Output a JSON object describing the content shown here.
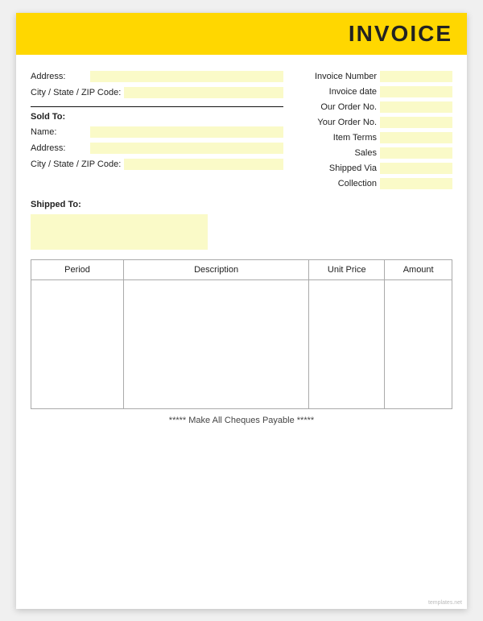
{
  "header": {
    "title": "INVOICE"
  },
  "left": {
    "address_label": "Address:",
    "city_label": "City / State / ZIP Code:",
    "sold_to_label": "Sold To:",
    "name_label": "Name:",
    "address2_label": "Address:",
    "city2_label": "City / State / ZIP Code:",
    "shipped_to_label": "Shipped To:"
  },
  "right": {
    "invoice_number_label": "Invoice Number",
    "invoice_date_label": "Invoice date",
    "our_order_label": "Our Order No.",
    "your_order_label": "Your Order No.",
    "item_terms_label": "Item Terms",
    "sales_label": "Sales",
    "shipped_via_label": "Shipped Via",
    "collection_label": "Collection"
  },
  "table": {
    "columns": [
      "Period",
      "Description",
      "Unit Price",
      "Amount"
    ]
  },
  "footer": {
    "text": "***** Make All Cheques Payable *****"
  },
  "watermark": "templates.net"
}
